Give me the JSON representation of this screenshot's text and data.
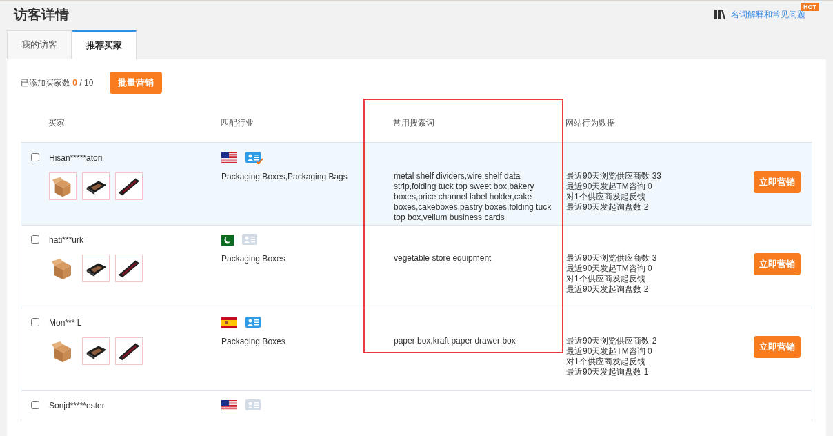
{
  "page_title": "访客详情",
  "help_link": {
    "label": "名词解释和常见问题",
    "badge": "HOT"
  },
  "tabs": [
    {
      "label": "我的访客",
      "selected": false
    },
    {
      "label": "推荐买家",
      "selected": true
    }
  ],
  "toolbar": {
    "added_label": "已添加买家数",
    "added_count": "0",
    "added_limit": "/ 10",
    "bulk_button": "批量营销"
  },
  "columns": [
    "买家",
    "匹配行业",
    "常用搜索词",
    "网站行为数据"
  ],
  "highlight_frame": true,
  "rows": [
    {
      "name": "Hisan*****atori",
      "checked": false,
      "highlighted": true,
      "flag": {
        "kind": "us"
      },
      "id_card": {
        "kind": "verified"
      },
      "products": [
        {
          "kind": "picture",
          "framed": true
        },
        {
          "kind": "picture",
          "framed": true
        },
        {
          "kind": "picture",
          "framed": true
        }
      ],
      "industry": "Packaging Boxes,Packaging Bags",
      "search_terms": "metal shelf dividers,wire shelf data strip,folding tuck top sweet box,bakery boxes,price channel label holder,cake boxes,cakeboxes,pastry boxes,folding tuck top box,vellum business cards",
      "stats": [
        "最近90天浏览供应商数 33",
        "最近90天发起TM咨询 0",
        "对1个供应商发起反馈",
        "最近90天发起询盘数 2"
      ],
      "action": "立即营销"
    },
    {
      "name": "hati***urk",
      "checked": false,
      "highlighted": false,
      "flag": {
        "kind": "pk"
      },
      "id_card": {
        "kind": "inactive"
      },
      "products": [
        {
          "kind": "picture",
          "framed": false
        },
        {
          "kind": "picture",
          "framed": true
        },
        {
          "kind": "picture",
          "framed": true
        }
      ],
      "industry": "Packaging Boxes",
      "search_terms": "vegetable store equipment",
      "stats": [
        "最近90天浏览供应商数 3",
        "最近90天发起TM咨询 0",
        "对1个供应商发起反馈",
        "最近90天发起询盘数 2"
      ],
      "action": "立即营销"
    },
    {
      "name": "Mon*** L",
      "checked": false,
      "highlighted": false,
      "flag": {
        "kind": "es"
      },
      "id_card": {
        "kind": "active"
      },
      "products": [
        {
          "kind": "picture",
          "framed": false
        },
        {
          "kind": "picture",
          "framed": true
        },
        {
          "kind": "picture",
          "framed": true
        }
      ],
      "industry": "Packaging Boxes",
      "search_terms": "paper box,kraft paper drawer box",
      "stats": [
        "最近90天浏览供应商数 2",
        "最近90天发起TM咨询 0",
        "对1个供应商发起反馈",
        "最近90天发起询盘数 1"
      ],
      "action": "立即营销"
    },
    {
      "name": "Sonjd*****ester",
      "checked": false,
      "highlighted": false,
      "flag": {
        "kind": "us"
      },
      "id_card": {
        "kind": "inactive"
      }
    }
  ]
}
